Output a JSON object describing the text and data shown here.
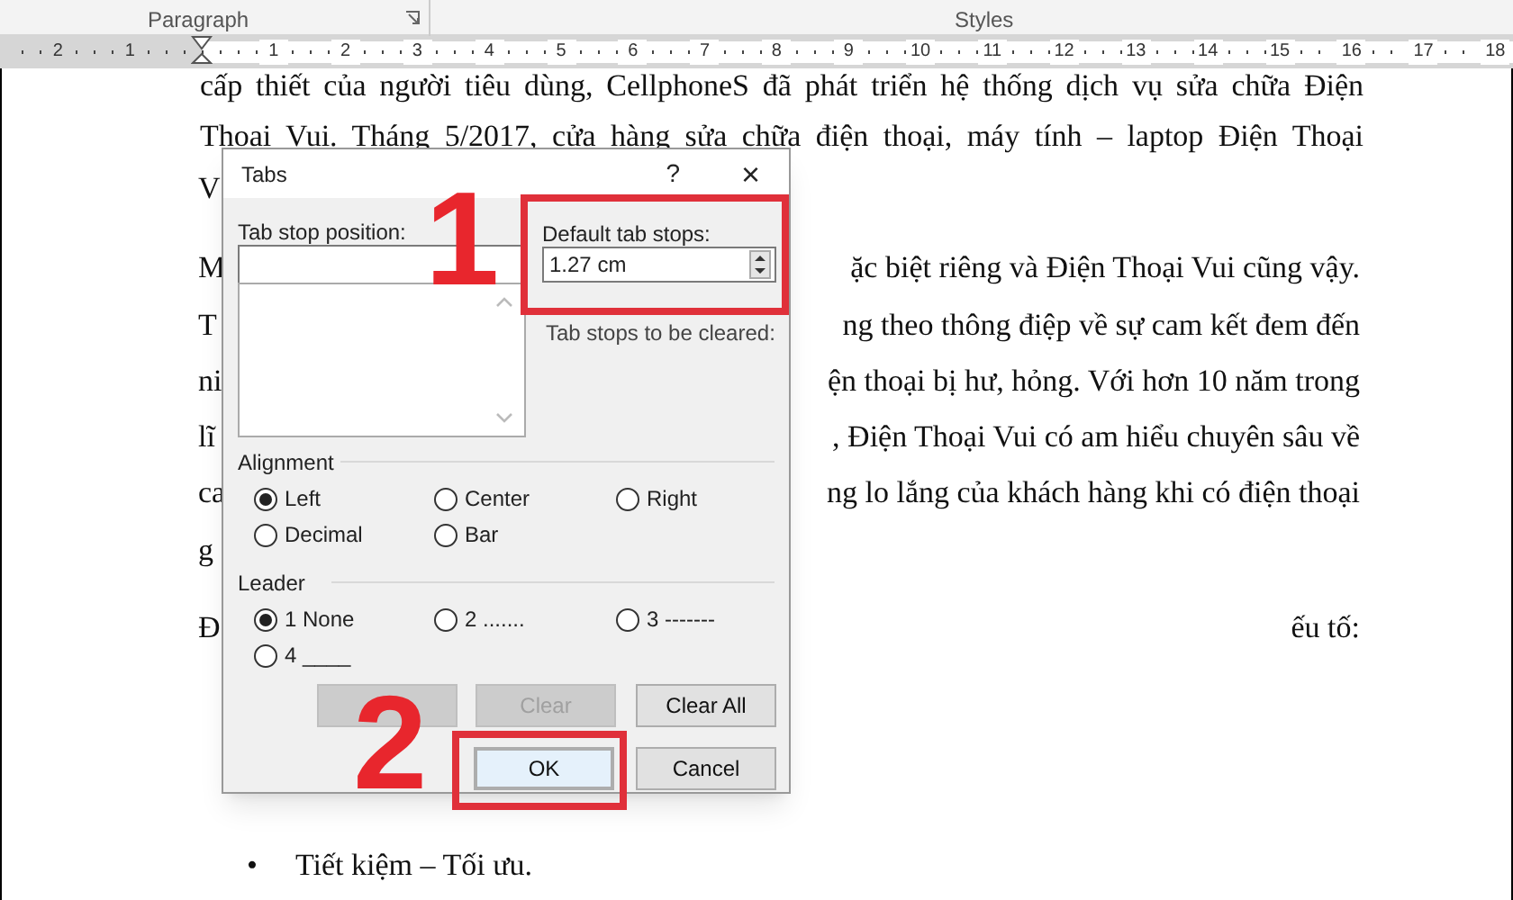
{
  "ribbon": {
    "groups": [
      {
        "label": "Paragraph"
      },
      {
        "label": "Styles"
      }
    ]
  },
  "ruler": {
    "labels": [
      "2",
      "1",
      "1",
      "2",
      "3",
      "4",
      "5",
      "6",
      "7",
      "8",
      "9",
      "10",
      "11",
      "12",
      "13",
      "14",
      "15",
      "16",
      "17",
      "18"
    ]
  },
  "document": {
    "lines": [
      {
        "kind": "full",
        "text": "cấp thiết của người tiêu dùng, CellphoneS đã phát triển hệ thống dịch vụ sửa chữa Điện"
      },
      {
        "kind": "full",
        "text": "Thoại Vui. Tháng 5/2017, cửa hàng sửa chữa điện thoại, máy tính – laptop Điện Thoại"
      },
      {
        "kind": "split",
        "left": "V"
      },
      {
        "kind": "split",
        "left": "M",
        "right": "ặc biệt riêng và Điện Thoại Vui cũng vậy."
      },
      {
        "kind": "split",
        "left": "T",
        "right": "ng theo thông điệp về sự cam kết đem đến"
      },
      {
        "kind": "split",
        "left": "ni",
        "right": "ện thoại bị hư, hỏng. Với hơn 10 năm trong"
      },
      {
        "kind": "split",
        "left": "lĩ",
        "right": ", Điện Thoại Vui có am hiểu chuyên sâu về"
      },
      {
        "kind": "split",
        "left": "ca",
        "right": "ng lo lắng của khách hàng khi có điện thoại"
      },
      {
        "kind": "split",
        "left": "g"
      },
      {
        "kind": "split",
        "left": "Đ",
        "right": "ếu tố:"
      },
      {
        "kind": "bullet",
        "bullet": "•",
        "text": "Tiết kiệm – Tối ưu."
      }
    ]
  },
  "dialog": {
    "title": "Tabs",
    "help": "?",
    "close": "×",
    "tab_stop_label": "Tab stop position:",
    "default_label": "Default tab stops:",
    "default_value": "1.27 cm",
    "cleared_label": "Tab stops to be cleared:",
    "alignment": {
      "label": "Alignment",
      "options": [
        {
          "label": "Left",
          "selected": true
        },
        {
          "label": "Center",
          "selected": false
        },
        {
          "label": "Right",
          "selected": false
        },
        {
          "label": "Decimal",
          "selected": false
        },
        {
          "label": "Bar",
          "selected": false
        }
      ]
    },
    "leader": {
      "label": "Leader",
      "options": [
        {
          "label": "1 None",
          "selected": true
        },
        {
          "label": "2 .......",
          "selected": false
        },
        {
          "label": "3 -------",
          "selected": false
        },
        {
          "label": "4 ____",
          "selected": false
        }
      ]
    },
    "buttons": [
      {
        "disabled": true,
        "default": false
      },
      {
        "label": "Clear",
        "disabled": true,
        "default": false
      },
      {
        "label": "Clear All",
        "disabled": false,
        "default": false
      },
      {
        "label": "OK",
        "disabled": false,
        "default": true
      },
      {
        "label": "Cancel",
        "disabled": false,
        "default": false
      }
    ]
  },
  "annotations": [
    {
      "label": "1"
    },
    {
      "label": "2"
    }
  ]
}
